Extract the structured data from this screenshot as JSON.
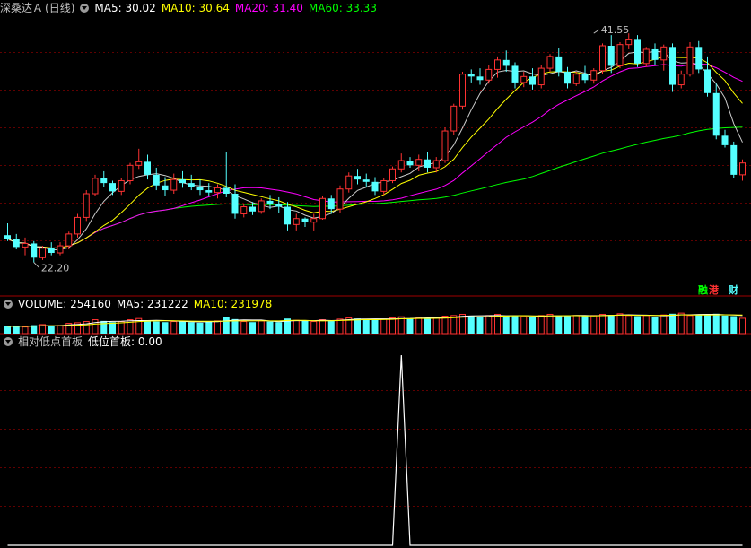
{
  "header": {
    "stock_name": "深桑达Ａ",
    "period": "(日线)",
    "ma5": "MA5: 30.02",
    "ma10": "MA10: 30.64",
    "ma20": "MA20: 31.40",
    "ma60": "MA60: 33.33"
  },
  "volume_header": {
    "volume": "VOLUME: 254160",
    "ma5": "MA5: 231222",
    "ma10": "MA10: 231978"
  },
  "indicator_header": {
    "name": "相对低点首板",
    "value": "低位首板: 0.00"
  },
  "badges": {
    "first": "融",
    "second": "港",
    "third": "财"
  },
  "colors": {
    "up": "#ff3232",
    "down": "#54ffff",
    "ma5": "#ffffff",
    "ma10": "#ffff00",
    "ma20": "#ff00ff",
    "ma60": "#00ff00",
    "separator": "#a00000",
    "grid": "#600000"
  },
  "chart_data": {
    "type": "candlestick",
    "price_range": [
      20.5,
      43.0
    ],
    "annotations": [
      {
        "label": "41.55",
        "x_index": 67,
        "price": 41.55
      },
      {
        "label": "22.20",
        "x_index": 3,
        "price": 22.2
      }
    ],
    "candles": [
      {
        "o": 24.5,
        "h": 25.5,
        "l": 24.0,
        "c": 24.2
      },
      {
        "o": 24.2,
        "h": 24.6,
        "l": 23.3,
        "c": 23.5
      },
      {
        "o": 23.5,
        "h": 24.3,
        "l": 22.8,
        "c": 23.8
      },
      {
        "o": 23.8,
        "h": 24.0,
        "l": 22.2,
        "c": 22.6
      },
      {
        "o": 22.6,
        "h": 23.6,
        "l": 22.4,
        "c": 23.4
      },
      {
        "o": 23.4,
        "h": 23.9,
        "l": 22.8,
        "c": 23.0
      },
      {
        "o": 23.0,
        "h": 23.9,
        "l": 22.8,
        "c": 23.6
      },
      {
        "o": 23.6,
        "h": 24.8,
        "l": 23.3,
        "c": 24.6
      },
      {
        "o": 24.6,
        "h": 26.3,
        "l": 24.3,
        "c": 26.0
      },
      {
        "o": 26.0,
        "h": 28.3,
        "l": 25.7,
        "c": 28.0
      },
      {
        "o": 28.0,
        "h": 29.6,
        "l": 27.8,
        "c": 29.3
      },
      {
        "o": 29.3,
        "h": 29.9,
        "l": 28.6,
        "c": 28.9
      },
      {
        "o": 28.9,
        "h": 29.1,
        "l": 27.9,
        "c": 28.2
      },
      {
        "o": 28.2,
        "h": 29.3,
        "l": 27.9,
        "c": 29.1
      },
      {
        "o": 29.1,
        "h": 30.6,
        "l": 28.8,
        "c": 30.4
      },
      {
        "o": 30.4,
        "h": 31.8,
        "l": 30.1,
        "c": 30.7
      },
      {
        "o": 30.7,
        "h": 31.3,
        "l": 29.2,
        "c": 29.6
      },
      {
        "o": 29.6,
        "h": 30.2,
        "l": 28.3,
        "c": 28.7
      },
      {
        "o": 28.7,
        "h": 29.4,
        "l": 27.8,
        "c": 28.3
      },
      {
        "o": 28.3,
        "h": 29.7,
        "l": 28.0,
        "c": 29.2
      },
      {
        "o": 29.2,
        "h": 29.9,
        "l": 28.5,
        "c": 28.9
      },
      {
        "o": 28.9,
        "h": 29.6,
        "l": 28.3,
        "c": 28.6
      },
      {
        "o": 28.6,
        "h": 29.2,
        "l": 27.9,
        "c": 28.3
      },
      {
        "o": 28.3,
        "h": 28.9,
        "l": 27.8,
        "c": 28.1
      },
      {
        "o": 28.1,
        "h": 28.8,
        "l": 27.6,
        "c": 28.5
      },
      {
        "o": 28.5,
        "h": 31.5,
        "l": 27.7,
        "c": 28.0
      },
      {
        "o": 28.0,
        "h": 28.8,
        "l": 25.9,
        "c": 26.3
      },
      {
        "o": 26.3,
        "h": 27.1,
        "l": 26.0,
        "c": 26.9
      },
      {
        "o": 26.9,
        "h": 27.3,
        "l": 26.2,
        "c": 26.5
      },
      {
        "o": 26.5,
        "h": 27.6,
        "l": 26.3,
        "c": 27.4
      },
      {
        "o": 27.4,
        "h": 27.9,
        "l": 26.7,
        "c": 27.1
      },
      {
        "o": 27.1,
        "h": 27.7,
        "l": 26.4,
        "c": 26.9
      },
      {
        "o": 26.9,
        "h": 27.3,
        "l": 24.9,
        "c": 25.4
      },
      {
        "o": 25.4,
        "h": 26.3,
        "l": 24.9,
        "c": 25.9
      },
      {
        "o": 25.9,
        "h": 26.0,
        "l": 25.2,
        "c": 25.6
      },
      {
        "o": 25.6,
        "h": 26.3,
        "l": 24.9,
        "c": 25.9
      },
      {
        "o": 25.9,
        "h": 27.8,
        "l": 25.8,
        "c": 27.6
      },
      {
        "o": 27.6,
        "h": 27.9,
        "l": 26.3,
        "c": 26.7
      },
      {
        "o": 26.7,
        "h": 28.7,
        "l": 26.4,
        "c": 28.4
      },
      {
        "o": 28.4,
        "h": 29.8,
        "l": 28.1,
        "c": 29.5
      },
      {
        "o": 29.5,
        "h": 30.1,
        "l": 28.8,
        "c": 29.2
      },
      {
        "o": 29.2,
        "h": 29.7,
        "l": 28.6,
        "c": 29.0
      },
      {
        "o": 29.0,
        "h": 29.4,
        "l": 27.9,
        "c": 28.2
      },
      {
        "o": 28.2,
        "h": 29.3,
        "l": 27.9,
        "c": 29.1
      },
      {
        "o": 29.1,
        "h": 30.3,
        "l": 28.9,
        "c": 30.1
      },
      {
        "o": 30.1,
        "h": 31.4,
        "l": 29.8,
        "c": 30.8
      },
      {
        "o": 30.8,
        "h": 31.1,
        "l": 30.2,
        "c": 30.4
      },
      {
        "o": 30.4,
        "h": 31.3,
        "l": 29.9,
        "c": 30.9
      },
      {
        "o": 30.9,
        "h": 31.5,
        "l": 29.8,
        "c": 30.2
      },
      {
        "o": 30.2,
        "h": 31.1,
        "l": 29.8,
        "c": 30.8
      },
      {
        "o": 30.8,
        "h": 33.6,
        "l": 30.6,
        "c": 33.3
      },
      {
        "o": 33.3,
        "h": 35.6,
        "l": 33.0,
        "c": 35.4
      },
      {
        "o": 35.4,
        "h": 38.3,
        "l": 35.1,
        "c": 38.1
      },
      {
        "o": 38.1,
        "h": 38.5,
        "l": 37.4,
        "c": 37.9
      },
      {
        "o": 37.9,
        "h": 38.6,
        "l": 37.2,
        "c": 37.6
      },
      {
        "o": 37.6,
        "h": 38.9,
        "l": 37.3,
        "c": 38.5
      },
      {
        "o": 38.5,
        "h": 39.6,
        "l": 37.8,
        "c": 39.3
      },
      {
        "o": 39.3,
        "h": 40.1,
        "l": 38.3,
        "c": 38.8
      },
      {
        "o": 38.8,
        "h": 39.1,
        "l": 36.9,
        "c": 37.4
      },
      {
        "o": 37.4,
        "h": 38.3,
        "l": 37.0,
        "c": 37.9
      },
      {
        "o": 37.9,
        "h": 38.6,
        "l": 36.8,
        "c": 37.2
      },
      {
        "o": 37.2,
        "h": 38.9,
        "l": 36.9,
        "c": 38.6
      },
      {
        "o": 38.6,
        "h": 39.8,
        "l": 38.3,
        "c": 39.6
      },
      {
        "o": 39.6,
        "h": 40.3,
        "l": 37.9,
        "c": 38.3
      },
      {
        "o": 38.3,
        "h": 38.7,
        "l": 36.9,
        "c": 37.3
      },
      {
        "o": 37.3,
        "h": 38.3,
        "l": 37.1,
        "c": 38.1
      },
      {
        "o": 38.1,
        "h": 38.8,
        "l": 37.3,
        "c": 37.6
      },
      {
        "o": 37.6,
        "h": 38.6,
        "l": 37.3,
        "c": 38.4
      },
      {
        "o": 38.4,
        "h": 40.7,
        "l": 38.1,
        "c": 40.5
      },
      {
        "o": 40.5,
        "h": 41.4,
        "l": 38.2,
        "c": 38.8
      },
      {
        "o": 38.8,
        "h": 40.8,
        "l": 38.6,
        "c": 40.6
      },
      {
        "o": 40.6,
        "h": 41.55,
        "l": 40.2,
        "c": 41.0
      },
      {
        "o": 41.0,
        "h": 41.4,
        "l": 38.7,
        "c": 39.0
      },
      {
        "o": 39.0,
        "h": 40.4,
        "l": 38.7,
        "c": 40.2
      },
      {
        "o": 40.2,
        "h": 40.7,
        "l": 38.9,
        "c": 39.3
      },
      {
        "o": 39.3,
        "h": 40.6,
        "l": 38.4,
        "c": 40.4
      },
      {
        "o": 40.4,
        "h": 40.7,
        "l": 36.6,
        "c": 37.2
      },
      {
        "o": 37.2,
        "h": 38.4,
        "l": 36.9,
        "c": 38.1
      },
      {
        "o": 38.1,
        "h": 40.8,
        "l": 37.9,
        "c": 40.4
      },
      {
        "o": 40.4,
        "h": 40.9,
        "l": 38.2,
        "c": 38.5
      },
      {
        "o": 38.5,
        "h": 39.6,
        "l": 36.2,
        "c": 36.5
      },
      {
        "o": 36.5,
        "h": 37.3,
        "l": 32.6,
        "c": 32.9
      },
      {
        "o": 32.9,
        "h": 33.4,
        "l": 31.9,
        "c": 32.1
      },
      {
        "o": 32.1,
        "h": 32.4,
        "l": 29.3,
        "c": 29.6
      },
      {
        "o": 29.6,
        "h": 30.9,
        "l": 29.1,
        "c": 30.6
      }
    ],
    "volume": [
      120,
      130,
      110,
      140,
      150,
      125,
      135,
      170,
      180,
      200,
      230,
      210,
      190,
      200,
      230,
      250,
      210,
      200,
      190,
      200,
      210,
      190,
      180,
      200,
      210,
      280,
      240,
      200,
      190,
      210,
      200,
      190,
      250,
      220,
      210,
      200,
      230,
      220,
      240,
      260,
      250,
      240,
      230,
      240,
      260,
      280,
      250,
      260,
      250,
      270,
      290,
      300,
      320,
      290,
      280,
      300,
      320,
      290,
      300,
      280,
      270,
      300,
      320,
      300,
      290,
      300,
      290,
      300,
      320,
      310,
      330,
      300,
      290,
      300,
      280,
      310,
      330,
      340,
      300,
      310,
      320,
      330,
      300,
      290,
      254
    ],
    "indicator": {
      "name": "低位首板",
      "value": 0.0,
      "signal_indices": [
        45
      ]
    }
  }
}
